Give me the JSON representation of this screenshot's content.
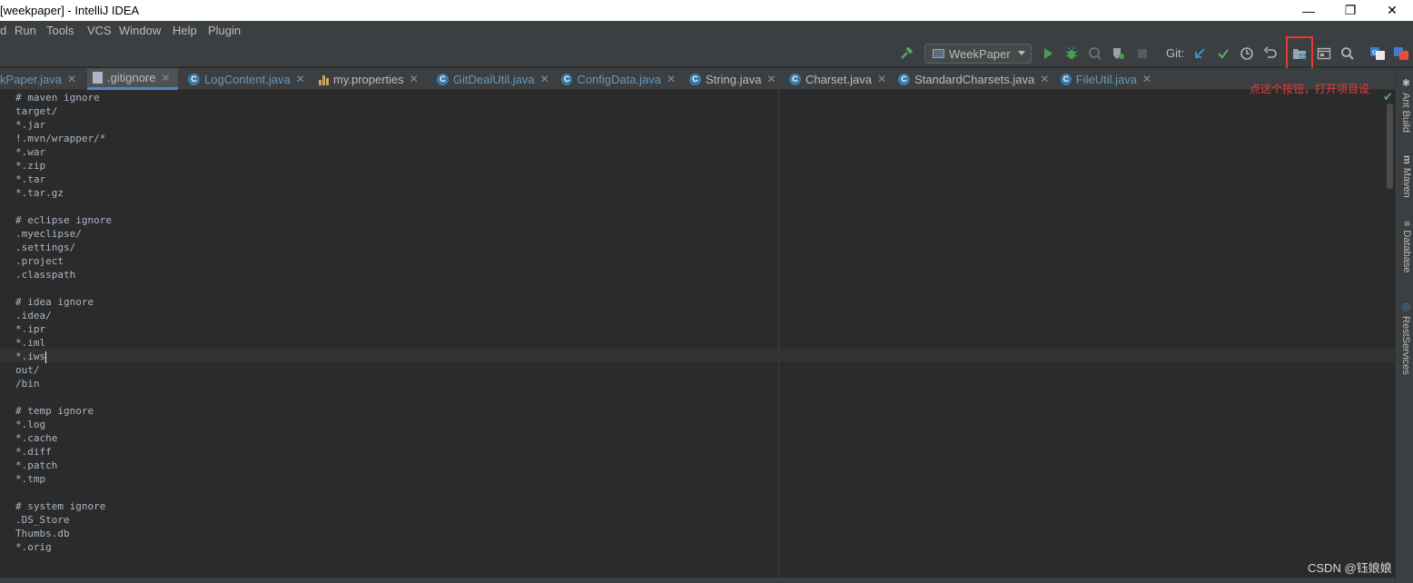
{
  "window": {
    "title": "[weekpaper] - IntelliJ IDEA",
    "minimize": "—",
    "restore": "❐",
    "close": "✕"
  },
  "menu": [
    "d",
    "Run",
    "Tools",
    "VCS",
    "Window",
    "Help",
    "Plugin"
  ],
  "toolbar": {
    "run_config": "WeekPaper",
    "git_label": "Git:"
  },
  "tabs": [
    {
      "label": "kPaper.java",
      "icon": "class-icon",
      "active": false
    },
    {
      "label": ".gitignore",
      "icon": "file-icon",
      "active": true
    },
    {
      "label": "LogContent.java",
      "icon": "class-icon",
      "active": false
    },
    {
      "label": "my.properties",
      "icon": "properties-icon",
      "active": false
    },
    {
      "label": "GitDealUtil.java",
      "icon": "class-icon",
      "active": false
    },
    {
      "label": "ConfigData.java",
      "icon": "class-icon",
      "active": false
    },
    {
      "label": "String.java",
      "icon": "class-icon",
      "active": false
    },
    {
      "label": "Charset.java",
      "icon": "class-icon",
      "active": false
    },
    {
      "label": "StandardCharsets.java",
      "icon": "class-icon",
      "active": false
    },
    {
      "label": "FileUtil.java",
      "icon": "class-icon",
      "active": false
    }
  ],
  "annotation": "点这个按钮，打开项目设",
  "editor": {
    "lines": [
      "# maven ignore",
      "target/",
      "*.jar",
      "!.mvn/wrapper/*",
      "*.war",
      "*.zip",
      "*.tar",
      "*.tar.gz",
      "",
      "# eclipse ignore",
      ".myeclipse/",
      ".settings/",
      ".project",
      ".classpath",
      "",
      "# idea ignore",
      ".idea/",
      "*.ipr",
      "*.iml",
      "*.iws",
      "out/",
      "/bin",
      "",
      "# temp ignore",
      "*.log",
      "*.cache",
      "*.diff",
      "*.patch",
      "*.tmp",
      "",
      "# system ignore",
      ".DS_Store",
      "Thumbs.db",
      "*.orig"
    ]
  },
  "right_tools": [
    "Ant Build",
    "Maven",
    "Database",
    "RestServices"
  ],
  "watermark": "CSDN @钰娘娘",
  "colors": {
    "accent": "#4a88c7",
    "annotation": "#e53935",
    "run_green": "#499c54"
  }
}
